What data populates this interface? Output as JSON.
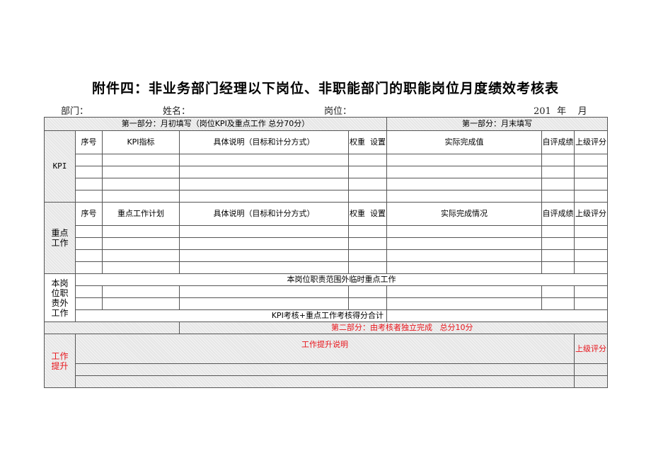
{
  "title": "附件四：非业务部门经理以下岗位、非职能部门的职能岗位月度绩效考核表",
  "meta": {
    "department_label": "部门：",
    "name_label": "姓名：",
    "position_label": "岗位：",
    "date_label": "201  年    月"
  },
  "part1": {
    "left_header": "第一部分：月初填写（岗位KPI及重点工作 总分70分）",
    "right_header": "第一部分：月末填写"
  },
  "kpi_section": {
    "label": "KPI",
    "columns": [
      "序号",
      "KPI指标",
      "具体说明（目标和计分方式）",
      "权重  设置",
      "实际完成值",
      "自评成绩",
      "上级评分"
    ],
    "row_count": 4
  },
  "key_work_section": {
    "label": "重点工作",
    "columns": [
      "序号",
      "重点工作计划",
      "具体说明（目标和计分方式）",
      "权重  设置",
      "实际完成情况",
      "自评成绩",
      "上级评分"
    ],
    "row_count": 4
  },
  "extra_work_section": {
    "label": "本岗位职责外工作",
    "header": "本岗位职责范围外临时重点工作",
    "row_count": 2,
    "total_label": "KPI考核+重点工作考核得分合计"
  },
  "part2": {
    "header": "第二部分：由考核者独立完成   总分10分",
    "label": "工作提升",
    "description_header": "工作提升说明",
    "score_header": "上级评分",
    "row_count": 2
  },
  "colors": {
    "accent_red": "#e8141b",
    "border": "#555555",
    "shade": "#e6e6e6"
  }
}
